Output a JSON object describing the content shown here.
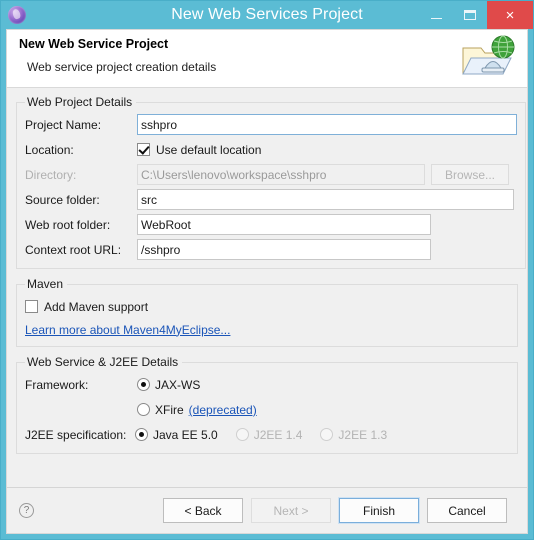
{
  "window": {
    "title": "New Web Services Project",
    "app_icon": "myeclipse-logo-icon",
    "controls": {
      "minimize": "minimize-icon",
      "maximize": "maximize-icon",
      "close": "×"
    },
    "accent_color": "#5bbcd4",
    "close_color": "#e04a4a",
    "body_color": "#f0f0f0"
  },
  "banner": {
    "title": "New Web Service Project",
    "subtitle": "Web service project creation details",
    "icon": "web-service-project-icon"
  },
  "web_project_details": {
    "legend": "Web Project Details",
    "project_name": {
      "label": "Project Name:",
      "value": "sshpro",
      "placeholder": ""
    },
    "location": {
      "label": "Location:",
      "checkbox_label": "Use default location",
      "checked": true
    },
    "directory": {
      "label": "Directory:",
      "value": "C:\\Users\\lenovo\\workspace\\sshpro",
      "disabled": true,
      "browse_label": "Browse..."
    },
    "source_folder": {
      "label": "Source folder:",
      "value": "src"
    },
    "web_root_folder": {
      "label": "Web root folder:",
      "value": "WebRoot"
    },
    "context_root_url": {
      "label": "Context root URL:",
      "value": "/sshpro"
    }
  },
  "maven": {
    "legend": "Maven",
    "add_support_label": "Add Maven support",
    "add_support_checked": false,
    "link_label": "Learn more about Maven4MyEclipse...",
    "link_color": "#1b55b8"
  },
  "web_service_j2ee": {
    "legend": "Web Service & J2EE Details",
    "framework": {
      "label": "Framework:",
      "options": [
        {
          "label": "JAX-WS",
          "selected": true,
          "disabled": false,
          "suffix": ""
        },
        {
          "label": "XFire",
          "selected": false,
          "disabled": false,
          "suffix": "(deprecated)"
        }
      ]
    },
    "j2ee_specification": {
      "label": "J2EE specification:",
      "options": [
        {
          "label": "Java EE 5.0",
          "selected": true,
          "disabled": false
        },
        {
          "label": "J2EE 1.4",
          "selected": false,
          "disabled": true
        },
        {
          "label": "J2EE 1.3",
          "selected": false,
          "disabled": true
        }
      ]
    }
  },
  "button_bar": {
    "help_icon": "?",
    "back": {
      "label": "< Back",
      "disabled": false
    },
    "next": {
      "label": "Next >",
      "disabled": true
    },
    "finish": {
      "label": "Finish",
      "disabled": false,
      "default": true
    },
    "cancel": {
      "label": "Cancel",
      "disabled": false
    }
  }
}
